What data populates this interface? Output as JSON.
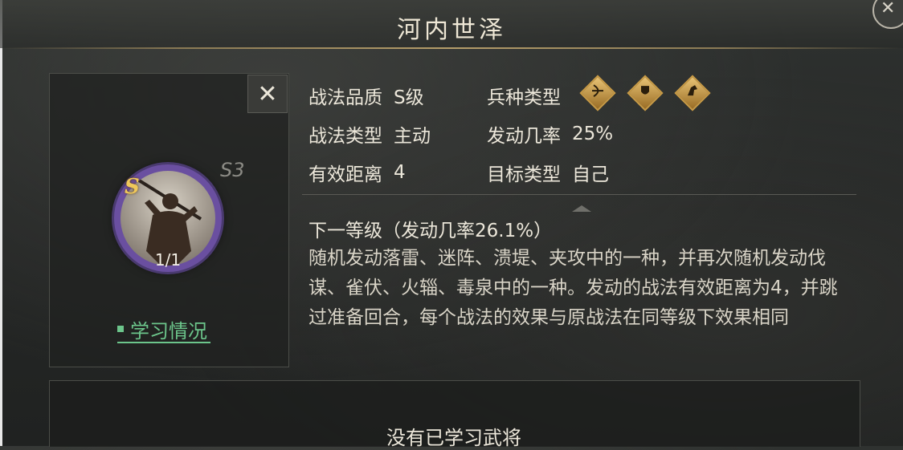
{
  "header": {
    "title": "河内世泽"
  },
  "card": {
    "close_label": "✕",
    "level_tag": "S3",
    "grade_badge": "S",
    "count": "1/1",
    "learn_link": "学习情况"
  },
  "info": {
    "quality_label": "战法品质",
    "quality_value": "S级",
    "type_label": "战法类型",
    "type_value": "主动",
    "range_label": "有效距离",
    "range_value": "4",
    "troop_label": "兵种类型",
    "rate_label": "发动几率",
    "rate_value": "25%",
    "target_label": "目标类型",
    "target_value": "自己",
    "troop_icons": [
      "bow-icon",
      "shield-icon",
      "horse-icon"
    ]
  },
  "next_level": "下一等级（发动几率26.1%）",
  "description": "随机发动落雷、迷阵、溃堤、夹攻中的一种，并再次随机发动伐谋、雀伏、火辎、毒泉中的一种。发动的战法有效距离为4，并跳过准备回合，每个战法的效果与原战法在同等级下效果相同",
  "bottom": {
    "empty_text": "没有已学习武将"
  },
  "colors": {
    "accent_gold": "#c79a46",
    "link_green": "#6cc58b",
    "emblem_purple": "#6a4fa0"
  }
}
